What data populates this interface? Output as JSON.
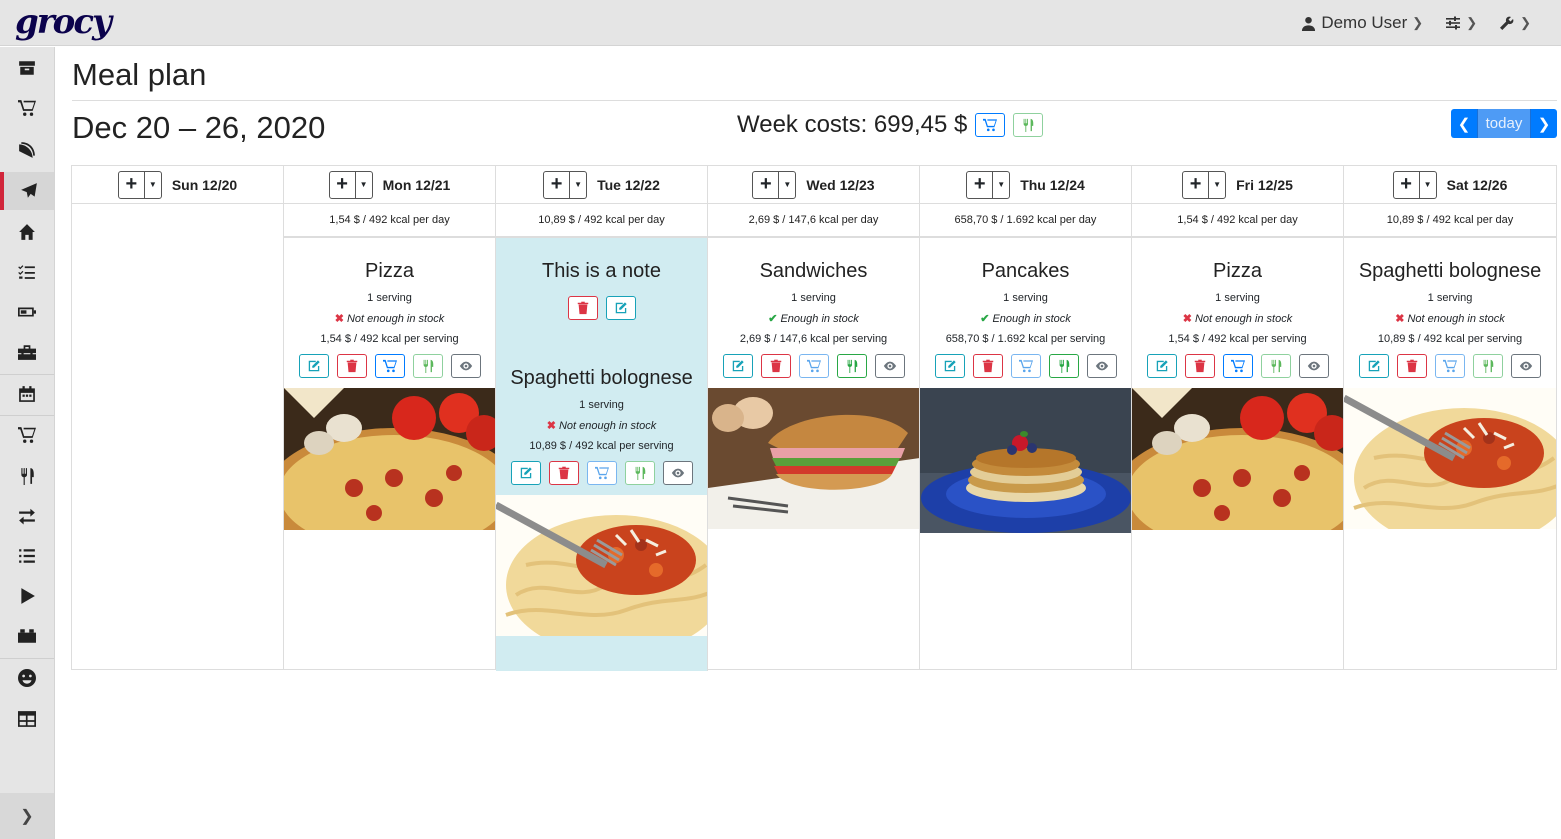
{
  "app": {
    "logo": "grocy"
  },
  "topnav": {
    "user": "Demo User"
  },
  "sidebar": {
    "items": [
      "stock-overview-icon",
      "shopping-list-icon",
      "recipes-icon",
      "meal-plan-icon",
      "chores-icon",
      "tasks-icon",
      "batteries-icon",
      "equipment-icon",
      "calendar-icon",
      "purchase-icon",
      "consume-icon",
      "transfer-icon",
      "inventory-icon",
      "open-icon",
      "products-icon",
      "smiley-icon",
      "table-icon"
    ],
    "active": "meal-plan-icon"
  },
  "page": {
    "title": "Meal plan",
    "date_range": "Dec 20 – 26, 2020",
    "week_costs": "Week costs: 699,45 $",
    "today_label": "today"
  },
  "days": [
    {
      "label": "Sun 12/20",
      "summary": ""
    },
    {
      "label": "Mon 12/21",
      "summary": "1,54 $ / 492 kcal per day"
    },
    {
      "label": "Tue 12/22",
      "summary": "10,89 $ / 492 kcal per day"
    },
    {
      "label": "Wed 12/23",
      "summary": "2,69 $ / 147,6 kcal per day"
    },
    {
      "label": "Thu 12/24",
      "summary": "658,70 $ / 1.692 kcal per day"
    },
    {
      "label": "Fri 12/25",
      "summary": "1,54 $ / 492 kcal per day"
    },
    {
      "label": "Sat 12/26",
      "summary": "10,89 $ / 492 kcal per day"
    }
  ],
  "entries": {
    "mon": {
      "name": "Pizza",
      "servings": "1 serving",
      "stock": "Not enough in stock",
      "cost": "1,54 $ / 492 kcal per serving"
    },
    "tue_note": {
      "text": "This is a note"
    },
    "tue": {
      "name": "Spaghetti bolognese",
      "servings": "1 serving",
      "stock": "Not enough in stock",
      "cost": "10,89 $ / 492 kcal per serving"
    },
    "wed": {
      "name": "Sandwiches",
      "servings": "1 serving",
      "stock": "Enough in stock",
      "cost": "2,69 $ / 147,6 kcal per serving"
    },
    "thu": {
      "name": "Pancakes",
      "servings": "1 serving",
      "stock": "Enough in stock",
      "cost": "658,70 $ / 1.692 kcal per serving"
    },
    "fri": {
      "name": "Pizza",
      "servings": "1 serving",
      "stock": "Not enough in stock",
      "cost": "1,54 $ / 492 kcal per serving"
    },
    "sat": {
      "name": "Spaghetti bolognese",
      "servings": "1 serving",
      "stock": "Not enough in stock",
      "cost": "10,89 $ / 492 kcal per serving"
    }
  },
  "colors": {
    "accent": "#007bff",
    "note_bg": "#d1ecf1",
    "ok": "#28a745",
    "danger": "#dc3545",
    "logo": "#0b024c"
  }
}
